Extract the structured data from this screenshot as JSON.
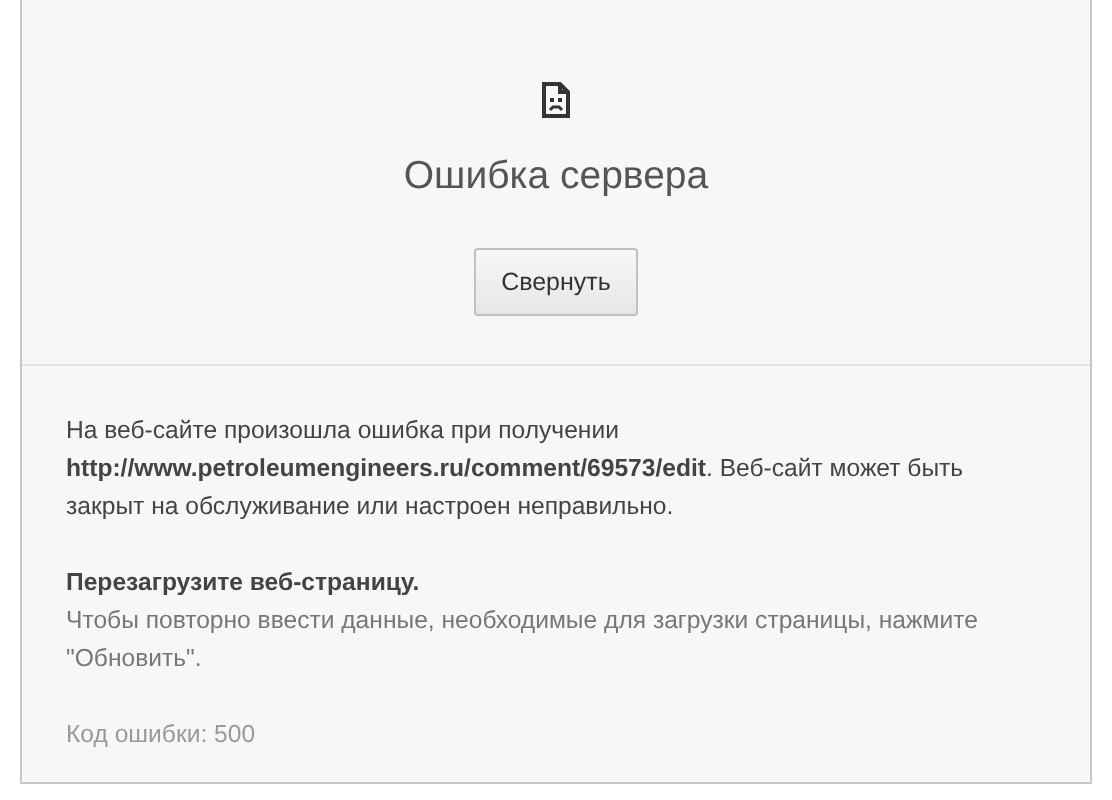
{
  "error": {
    "title": "Ошибка сервера",
    "button": "Свернуть",
    "details": {
      "message": "На веб-сайте произошла ошибка при получении **http://www.petroleumengineers.ru/comment/69573/edit**. Веб-сайт может быть закрыт на обслуживание или настроен неправильно.",
      "suggestion_heading": "Перезагрузите веб-страницу.",
      "suggestion": "Чтобы повторно ввести данные, необходимые для загрузки страницы, нажмите \"Обновить\".",
      "error_code": "Код ошибки: 500"
    }
  }
}
